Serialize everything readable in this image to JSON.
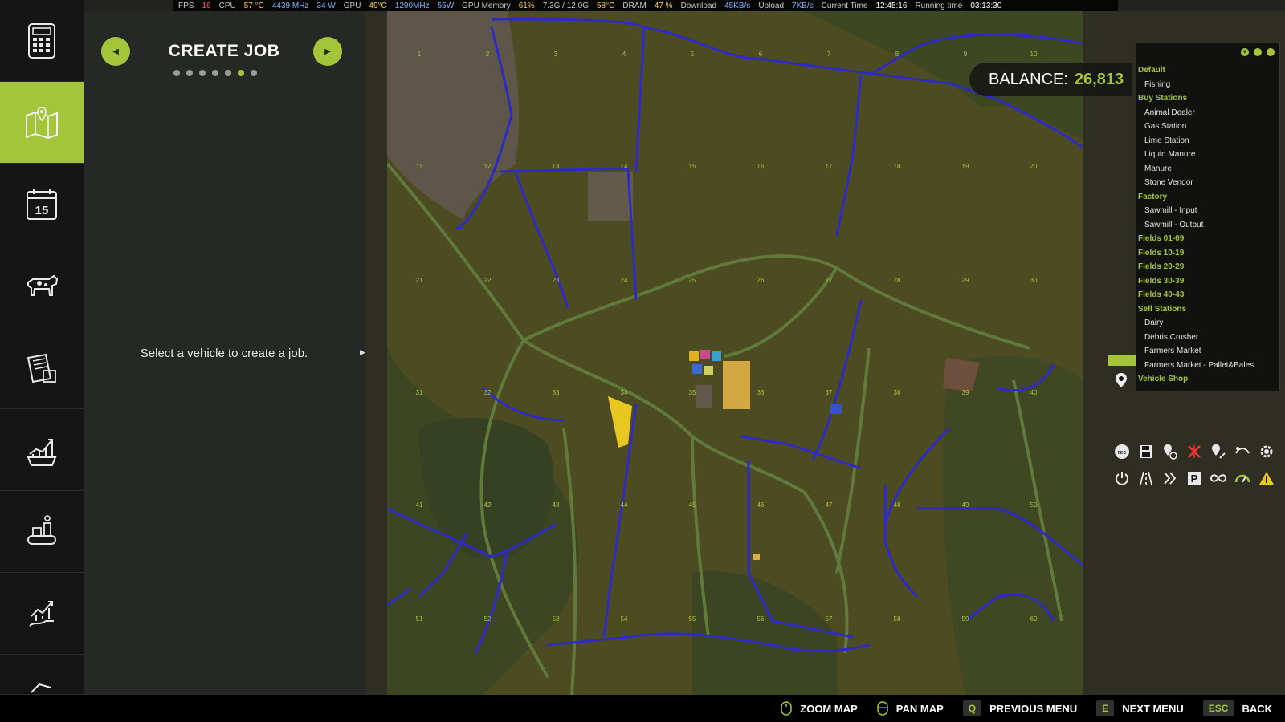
{
  "stats": {
    "fps_label": "FPS",
    "fps": "16",
    "cpu_label": "CPU",
    "cpu_temp": "57 °C",
    "cpu_clock": "4439 MHz",
    "cpu_power": "34 W",
    "gpu_label": "GPU",
    "gpu_temp": "49°C",
    "gpu_clock": "1290MHz",
    "gpu_power": "55W",
    "gpu_mem_label": "GPU Memory",
    "gpu_mem_pct": "61%",
    "gpu_mem": "7.3G / 12.0G",
    "gpu_mem_temp": "58°C",
    "dram_label": "DRAM",
    "dram_pct": "47 %",
    "download_label": "Download",
    "download": "45KB/s",
    "upload_label": "Upload",
    "upload": "7KB/s",
    "time_label": "Current Time",
    "time": "12:45:16",
    "running_label": "Running time",
    "running": "03:13:30"
  },
  "sidebar": {
    "items": [
      {
        "icon": "calculator-icon"
      },
      {
        "icon": "map-icon"
      },
      {
        "icon": "calendar-icon",
        "number": "15"
      },
      {
        "icon": "cow-icon"
      },
      {
        "icon": "newspaper-icon"
      },
      {
        "icon": "finance-chart-icon"
      },
      {
        "icon": "production-icon"
      },
      {
        "icon": "price-trend-icon"
      },
      {
        "icon": "check-icon"
      }
    ]
  },
  "panel": {
    "title": "CREATE JOB",
    "prev_icon": "arrow-left-icon",
    "next_icon": "arrow-right-icon",
    "page_count": 7,
    "active_page": 6,
    "message": "Select a vehicle to create a job."
  },
  "balance": {
    "label": "BALANCE:",
    "value": "26,813"
  },
  "hotspots": [
    {
      "type": "cat",
      "label": "Default"
    },
    {
      "type": "item",
      "label": "Fishing"
    },
    {
      "type": "cat",
      "label": "Buy Stations"
    },
    {
      "type": "item",
      "label": "Animal Dealer"
    },
    {
      "type": "item",
      "label": "Gas Station"
    },
    {
      "type": "item",
      "label": "Lime Station"
    },
    {
      "type": "item",
      "label": "Liquid Manure"
    },
    {
      "type": "item",
      "label": "Manure"
    },
    {
      "type": "item",
      "label": "Stone Vendor"
    },
    {
      "type": "cat",
      "label": "Factory"
    },
    {
      "type": "item",
      "label": "Sawmill - Input"
    },
    {
      "type": "item",
      "label": "Sawmill - Output"
    },
    {
      "type": "cat",
      "label": "Fields 01-09"
    },
    {
      "type": "cat",
      "label": "Fields 10-19"
    },
    {
      "type": "cat",
      "label": "Fields 20-29"
    },
    {
      "type": "cat",
      "label": "Fields 30-39"
    },
    {
      "type": "cat",
      "label": "Fields 40-43"
    },
    {
      "type": "cat",
      "label": "Sell Stations"
    },
    {
      "type": "item",
      "label": "Dairy"
    },
    {
      "type": "item",
      "label": "Debris Crusher"
    },
    {
      "type": "item",
      "label": "Farmers Market"
    },
    {
      "type": "item",
      "label": "Farmers Market - Pallet&Bales"
    },
    {
      "type": "cat",
      "label": "Vehicle Shop"
    }
  ],
  "hotspot_controls": [
    "+",
    "",
    ""
  ],
  "tools": [
    {
      "label": "rec",
      "icon": "record-icon"
    },
    {
      "icon": "save-icon"
    },
    {
      "icon": "waypoint-add-icon"
    },
    {
      "icon": "waypoint-delete-icon"
    },
    {
      "icon": "waypoint-edit-icon"
    },
    {
      "icon": "route-icon"
    },
    {
      "icon": "settings-gear-icon"
    },
    {
      "icon": "power-icon"
    },
    {
      "icon": "road-icon"
    },
    {
      "icon": "fast-forward-icon"
    },
    {
      "label": "P",
      "icon": "parking-icon"
    },
    {
      "icon": "loop-icon"
    },
    {
      "icon": "speedometer-icon"
    },
    {
      "icon": "warning-icon"
    }
  ],
  "map_fields": [
    "1",
    "2",
    "3",
    "4",
    "5",
    "6",
    "7",
    "8",
    "9",
    "10",
    "11",
    "12",
    "13",
    "14",
    "15",
    "16",
    "17",
    "18",
    "19",
    "20",
    "21",
    "22",
    "23",
    "24",
    "25",
    "26",
    "27",
    "28",
    "29",
    "30",
    "31",
    "32",
    "33",
    "34",
    "35",
    "36",
    "37",
    "38",
    "39",
    "40",
    "41",
    "42",
    "43",
    "44",
    "45",
    "46",
    "47",
    "48",
    "49",
    "50",
    "51",
    "52",
    "53",
    "54",
    "55",
    "56",
    "57",
    "58",
    "59",
    "60"
  ],
  "bottom": {
    "zoom": "ZOOM MAP",
    "pan": "PAN MAP",
    "prev_key": "Q",
    "prev": "PREVIOUS MENU",
    "next_key": "E",
    "next": "NEXT MENU",
    "back_key": "ESC",
    "back": "BACK"
  }
}
